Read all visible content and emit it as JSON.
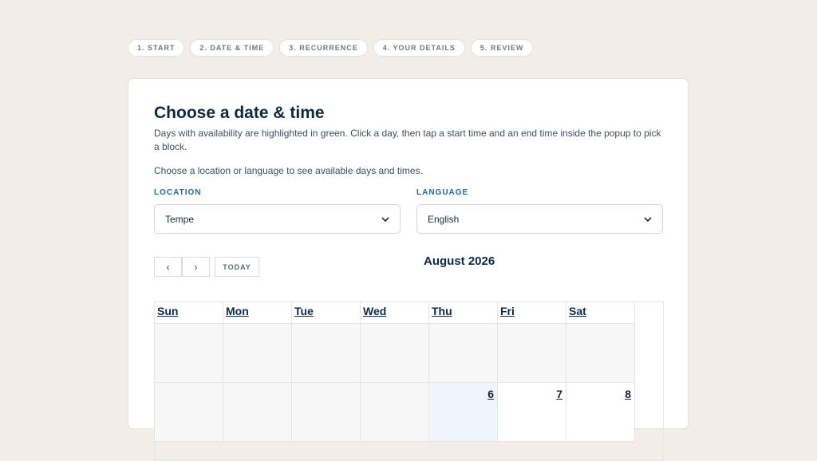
{
  "steps": [
    "1. START",
    "2. DATE & TIME",
    "3. RECURRENCE",
    "4. YOUR DETAILS",
    "5. REVIEW"
  ],
  "card": {
    "title": "Choose a date & time",
    "intro": "Days with availability are highlighted in green. Click a day, then tap a start time and an end time inside the popup to pick a block.",
    "hint": "Choose a location or language to see available days and times."
  },
  "location": {
    "label": "LOCATION",
    "value": "Tempe"
  },
  "language": {
    "label": "LANGUAGE",
    "value": "English"
  },
  "calendar": {
    "prev_icon": "chevron-left-icon",
    "next_icon": "chevron-right-icon",
    "prev_glyph": "‹",
    "next_glyph": "›",
    "today_label": "TODAY",
    "month": "August 2026",
    "weekdays": [
      "Sun",
      "Mon",
      "Tue",
      "Wed",
      "Thu",
      "Fri",
      "Sat"
    ],
    "week2": [
      "",
      "",
      "",
      "",
      "6",
      "7",
      "8"
    ]
  },
  "colors": {
    "accent": "#1a6d9e",
    "heading": "#0d2a45",
    "background": "#f2ede7"
  }
}
